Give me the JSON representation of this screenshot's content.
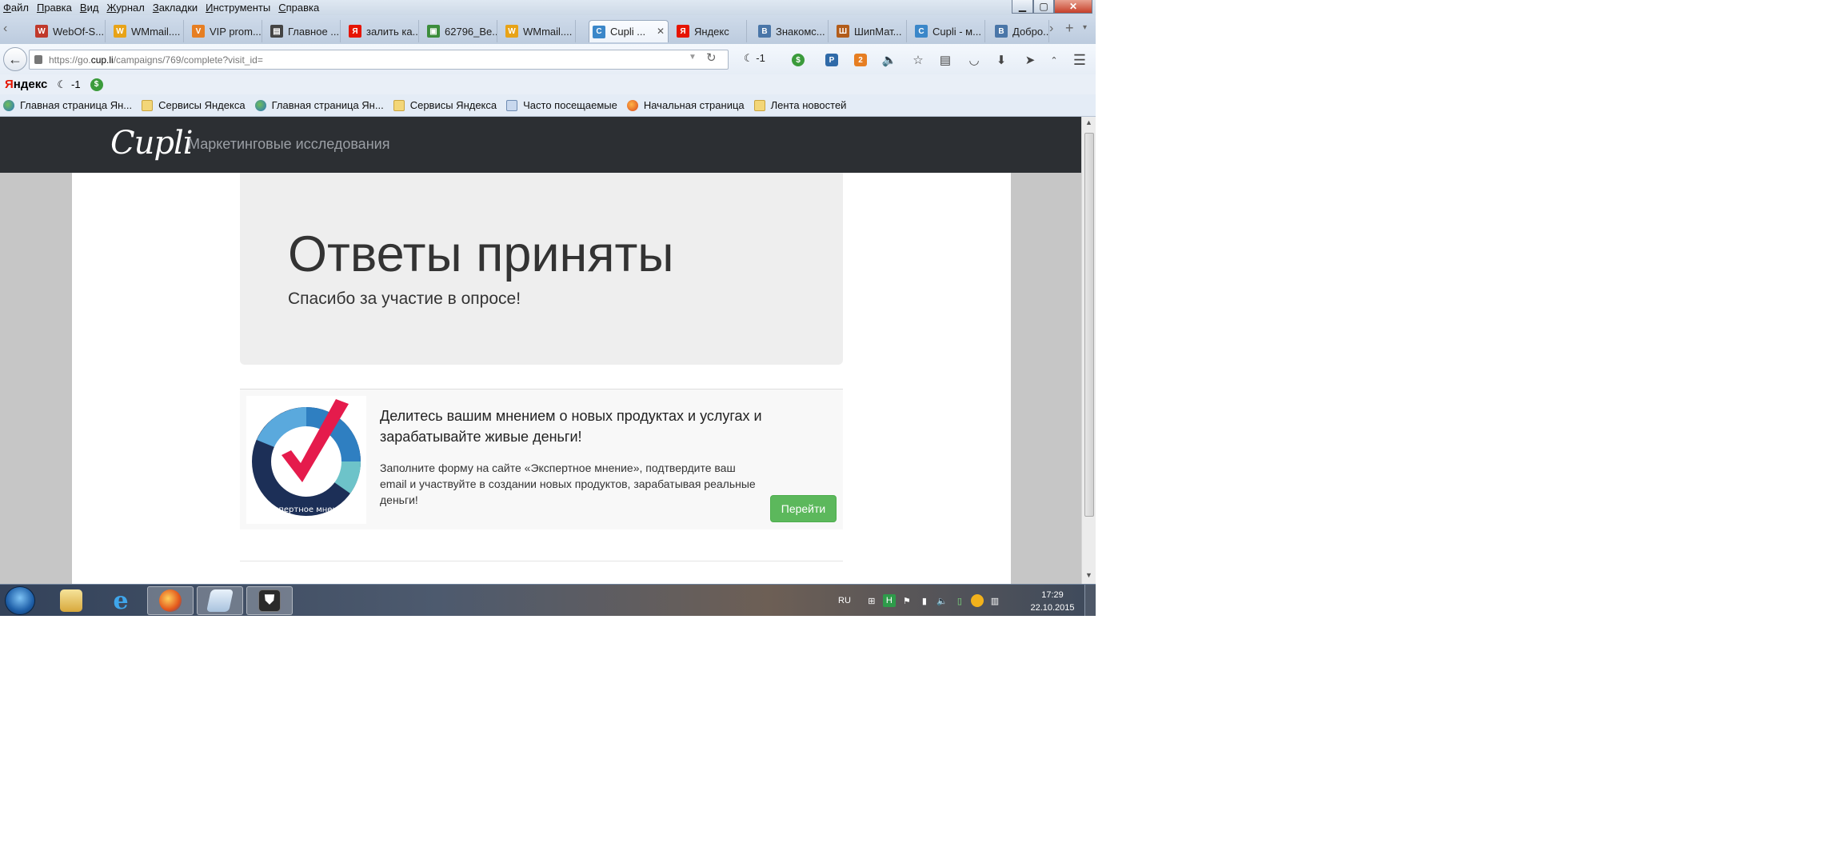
{
  "menu": [
    "Файл",
    "Правка",
    "Вид",
    "Журнал",
    "Закладки",
    "Инструменты",
    "Справка"
  ],
  "window_controls": {
    "minimize": "▁",
    "maximize": "▢",
    "close": "✕"
  },
  "tabs": [
    {
      "label": "WebOf-S...",
      "icon_color": "#c0392b",
      "icon": "W"
    },
    {
      "label": "WMmail....",
      "icon_color": "#e8a317",
      "icon": "W"
    },
    {
      "label": "VIP prom...",
      "icon_color": "#e67e22",
      "icon": "V"
    },
    {
      "label": "Главное ...",
      "icon_color": "#444444",
      "icon": "▤"
    },
    {
      "label": "залить ка...",
      "icon_color": "#e61400",
      "icon": "Я"
    },
    {
      "label": "62796_Be...",
      "icon_color": "#3c8d3c",
      "icon": "▣"
    },
    {
      "label": "WMmail....",
      "icon_color": "#e8a317",
      "icon": "W"
    },
    {
      "label": "Cupli ...",
      "icon_color": "#3b87c9",
      "icon": "C",
      "active": true
    },
    {
      "label": "Яндекс",
      "icon_color": "#e61400",
      "icon": "Я"
    },
    {
      "label": "Знакомс...",
      "icon_color": "#4a76a8",
      "icon": "В"
    },
    {
      "label": "ШипМат...",
      "icon_color": "#b25c1a",
      "icon": "Ш"
    },
    {
      "label": "Cupli - м...",
      "icon_color": "#3b87c9",
      "icon": "C"
    },
    {
      "label": "Добро...",
      "icon_color": "#4a76a8",
      "icon": "В"
    }
  ],
  "nav": {
    "url_prefix": "https://go.",
    "url_host": "cup.li",
    "url_path": "/campaigns/769/complete?visit_id=",
    "weather": "-1"
  },
  "yandex_bar": {
    "logo_y": "Я",
    "logo_rest": "ндекс",
    "weather": "-1"
  },
  "bookmarks": [
    {
      "label": "Главная страница Ян...",
      "icon": "globe"
    },
    {
      "label": "Сервисы Яндекса",
      "icon": "folder"
    },
    {
      "label": "Главная страница Ян...",
      "icon": "globe"
    },
    {
      "label": "Сервисы Яндекса",
      "icon": "folder"
    },
    {
      "label": "Часто посещаемые",
      "icon": "folder"
    },
    {
      "label": "Начальная страница",
      "icon": "globe"
    },
    {
      "label": "Лента новостей",
      "icon": "folder"
    }
  ],
  "site": {
    "logo": "Cupli",
    "nav_link": "Маркетинговые исследования",
    "heading": "Ответы приняты",
    "subheading": "Спасибо за участие в опросе!",
    "promo": {
      "title": "Делитесь вашим мнением о новых продуктах и услугах и зарабатывайте живые деньги!",
      "text": "Заполните форму на сайте «Экспертное мнение», подтвердите ваш email и участвуйте в создании новых продуктов, зарабатывая реальные деньги!",
      "button": "Перейти",
      "logo_caption": "экспертное мнение"
    }
  },
  "taskbar": {
    "lang": "RU",
    "time": "17:29",
    "date": "22.10.2015"
  }
}
